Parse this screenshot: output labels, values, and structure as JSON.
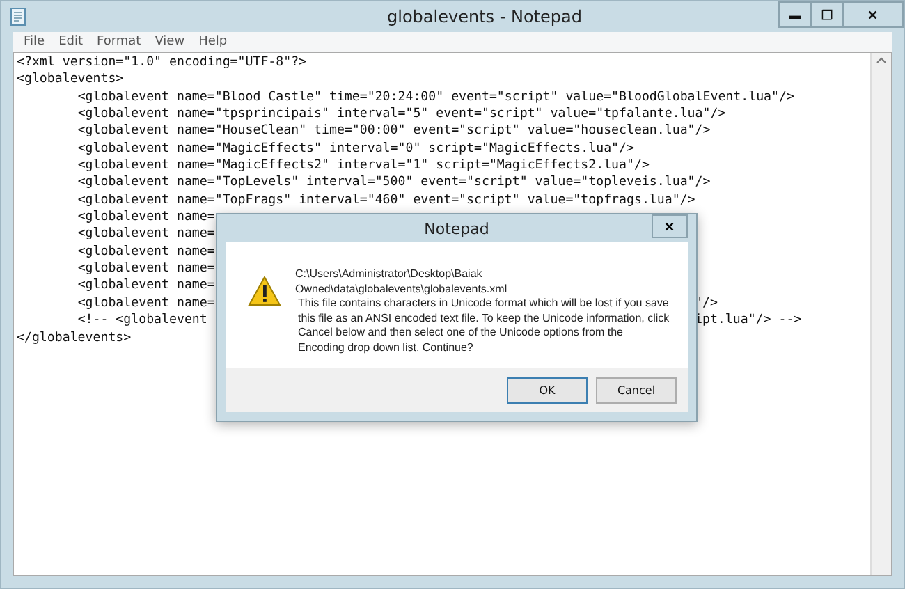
{
  "window": {
    "title": "globalevents - Notepad",
    "buttons": [
      "▬",
      "❐",
      "✕"
    ]
  },
  "menu": [
    "File",
    "Edit",
    "Format",
    "View",
    "Help"
  ],
  "editor": {
    "lines": [
      {
        "left": "<?xml version=\"1.0\" encoding=\"UTF-8\"?>"
      },
      {
        "left": "<globalevents>"
      },
      {
        "left": "\t<globalevent name=\"Blood Castle\" time=\"20:24:00\" event=\"script\" value=\"BloodGlobalEvent.lua\"/>"
      },
      {
        "left": "\t<globalevent name=\"tpsprincipais\" interval=\"5\" event=\"script\" value=\"tpfalante.lua\"/>"
      },
      {
        "left": "\t<globalevent name=\"HouseClean\" time=\"00:00\" event=\"script\" value=\"houseclean.lua\"/>"
      },
      {
        "left": "\t<globalevent name=\"MagicEffects\" interval=\"0\" script=\"MagicEffects.lua\"/>"
      },
      {
        "left": "\t<globalevent name=\"MagicEffects2\" interval=\"1\" script=\"MagicEffects2.lua\"/>"
      },
      {
        "left": "\t<globalevent name=\"TopLevels\" interval=\"500\" event=\"script\" value=\"topleveis.lua\"/>"
      },
      {
        "left": "\t<globalevent name=\"TopFrags\" interval=\"460\" event=\"script\" value=\"topfrags.lua\"/>"
      },
      {
        "left": "\t<globalevent name="
      },
      {
        "left": "\t<globalevent name="
      },
      {
        "left": "\t<globalevent name="
      },
      {
        "left": "\t<globalevent name="
      },
      {
        "left": "\t<globalevent name="
      },
      {
        "left": "\t<globalevent name=",
        "right": "\"/>"
      },
      {
        "left": "\t<!-- <globalevent",
        "right": "ipt.lua\"/> -->"
      },
      {
        "left": "</globalevents>"
      }
    ]
  },
  "dialog": {
    "title": "Notepad",
    "close": "✕",
    "path_line_1": "C:\\Users\\Administrator\\Desktop\\Baiak",
    "path_line_2": "Owned\\data\\globalevents\\globalevents.xml",
    "message": "This file contains characters in Unicode format which will be lost if you save this file as an ANSI encoded text file. To keep the Unicode information, click Cancel below and then select one of the Unicode options from the Encoding drop down list. Continue?",
    "buttons": [
      {
        "label": "OK",
        "selected": true
      },
      {
        "label": "Cancel",
        "selected": false
      }
    ]
  }
}
